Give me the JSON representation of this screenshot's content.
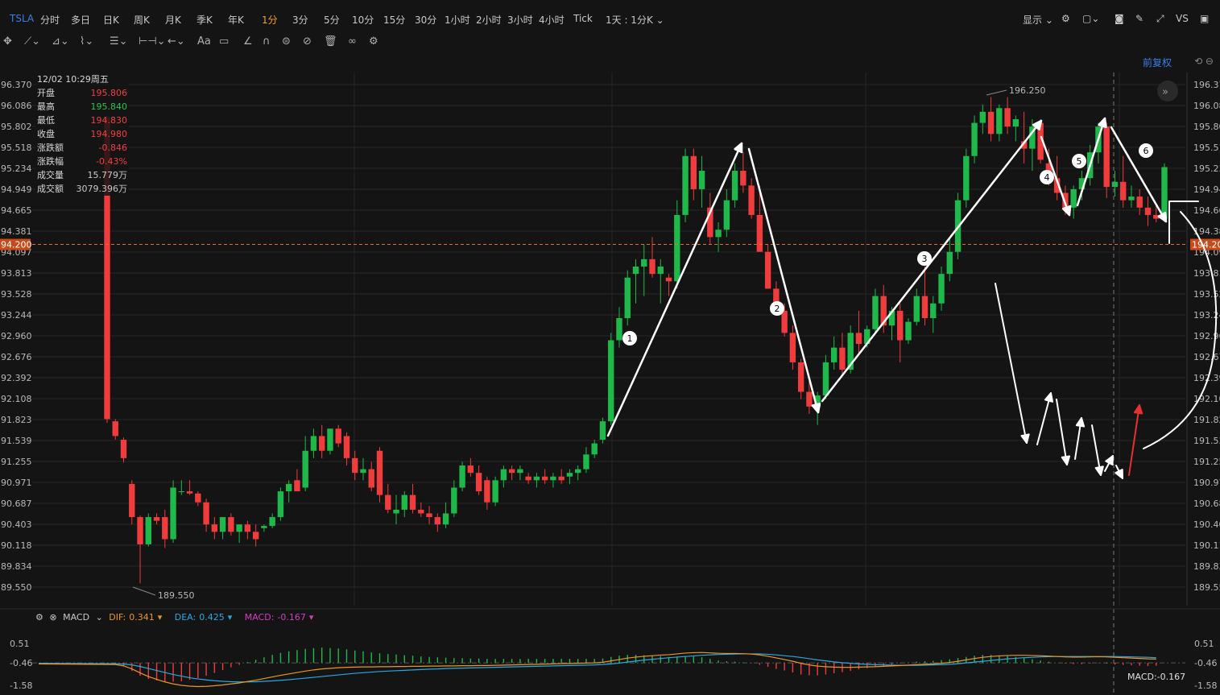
{
  "topbar": {
    "symbol": "TSLA",
    "periods": [
      "分时",
      "多日",
      "日K",
      "周K",
      "月K",
      "季K",
      "年K",
      "1分",
      "3分",
      "5分",
      "10分",
      "15分",
      "30分",
      "1小时",
      "2小时",
      "3小时",
      "4小时",
      "Tick"
    ],
    "active_period": "1分",
    "range_label": "1天 : 1分K",
    "display_label": "显示",
    "vs_label": "VS"
  },
  "toolbar": {
    "tools": [
      "move-tool",
      "line-tool",
      "channel-tool",
      "pattern-tool",
      "fib-tool",
      "measure-tool",
      "arrow-tool",
      "text-tool",
      "note-tool",
      "ruler-tool",
      "magnet-tool",
      "hide-tool",
      "lock-tool",
      "delete-tool",
      "link-tool",
      "settings-tool"
    ],
    "text_tool_label": "Aa"
  },
  "restore_label": "前复权",
  "info_box": {
    "date": "12/02 10:29周五",
    "rows": [
      {
        "label": "开盘",
        "value": "195.806",
        "color": "red"
      },
      {
        "label": "最高",
        "value": "195.840",
        "color": "green"
      },
      {
        "label": "最低",
        "value": "194.830",
        "color": "red"
      },
      {
        "label": "收盘",
        "value": "194.980",
        "color": "red"
      },
      {
        "label": "涨跌额",
        "value": "-0.846",
        "color": "red"
      },
      {
        "label": "涨跌幅",
        "value": "-0.43%",
        "color": "red"
      },
      {
        "label": "成交量",
        "value": "15.779万",
        "color": "white"
      },
      {
        "label": "成交额",
        "value": "3079.396万",
        "color": "white"
      }
    ]
  },
  "macd": {
    "label": "MACD",
    "dif_label": "DIF:",
    "dif_value": "0.341",
    "dea_label": "DEA:",
    "dea_value": "0.425",
    "macd_label": "MACD:",
    "macd_value": "-0.167",
    "axis_ticks": [
      "0.51",
      "-0.46",
      "-1.58"
    ],
    "bottom_readout": "MACD:-0.167"
  },
  "colors": {
    "up": "#1fb84a",
    "down": "#f03c3c",
    "bg": "#141414",
    "grid": "#262626",
    "price_line": "#e07020",
    "dif": "#e8962a",
    "dea": "#2aa8e0",
    "annotation": "#ffffff",
    "accent": "#3b7ee8"
  },
  "chart_data": {
    "type": "candlestick",
    "symbol": "TSLA",
    "interval": "1分",
    "y_ticks": [
      96.37,
      96.086,
      95.802,
      95.518,
      95.234,
      94.949,
      94.665,
      94.381,
      94.097,
      93.813,
      93.528,
      93.244,
      92.96,
      92.676,
      92.392,
      92.108,
      91.823,
      91.539,
      91.255,
      90.971,
      90.687,
      90.403,
      90.118,
      89.834,
      89.55
    ],
    "y_tick_labels_left": [
      "96.370",
      "96.086",
      "95.802",
      "95.518",
      "95.234",
      "94.949",
      "94.665",
      "94.381",
      "94.097",
      "93.813",
      "93.528",
      "93.244",
      "92.960",
      "92.676",
      "92.392",
      "92.108",
      "91.823",
      "91.539",
      "91.255",
      "90.971",
      "90.687",
      "90.403",
      "90.118",
      "89.834",
      "89.550"
    ],
    "y_tick_labels_right": [
      "196.37",
      "196.08",
      "195.80",
      "195.51",
      "195.23",
      "194.94",
      "194.66",
      "194.38",
      "194.09",
      "193.81",
      "193.52",
      "193.24",
      "192.96",
      "192.67",
      "192.39",
      "192.10",
      "191.82",
      "191.53",
      "191.25",
      "190.97",
      "190.68",
      "190.40",
      "190.11",
      "189.83",
      "189.55"
    ],
    "ylim": [
      189.5,
      196.5
    ],
    "current_price": 194.2,
    "current_price_label": "94.200",
    "right_price_label": "194.20",
    "high_marker": {
      "value": 196.25,
      "label": "196.250"
    },
    "low_marker": {
      "value": 189.55,
      "label": "189.550"
    },
    "candles": [
      [
        195.93,
        195.95,
        191.78,
        191.83
      ],
      [
        191.8,
        191.83,
        191.55,
        191.6
      ],
      [
        191.55,
        191.58,
        191.24,
        191.3
      ],
      [
        190.95,
        191.0,
        190.4,
        190.5
      ],
      [
        190.5,
        190.52,
        189.6,
        190.13
      ],
      [
        190.13,
        190.55,
        190.1,
        190.5
      ],
      [
        190.5,
        190.55,
        190.4,
        190.45
      ],
      [
        190.5,
        190.6,
        190.08,
        190.2
      ],
      [
        190.2,
        191.0,
        190.15,
        190.9
      ],
      [
        190.85,
        191.0,
        190.8,
        190.85
      ],
      [
        190.85,
        191.0,
        190.8,
        190.82
      ],
      [
        190.82,
        190.85,
        190.65,
        190.7
      ],
      [
        190.7,
        190.75,
        190.3,
        190.4
      ],
      [
        190.4,
        190.5,
        190.2,
        190.3
      ],
      [
        190.3,
        190.5,
        190.2,
        190.5
      ],
      [
        190.5,
        190.55,
        190.25,
        190.3
      ],
      [
        190.3,
        190.4,
        190.15,
        190.4
      ],
      [
        190.4,
        190.45,
        190.2,
        190.3
      ],
      [
        190.3,
        190.4,
        190.1,
        190.2
      ],
      [
        190.35,
        190.4,
        190.3,
        190.38
      ],
      [
        190.38,
        190.55,
        190.35,
        190.5
      ],
      [
        190.5,
        190.9,
        190.45,
        190.85
      ],
      [
        190.85,
        191.0,
        190.7,
        190.95
      ],
      [
        191.0,
        191.15,
        190.85,
        190.85
      ],
      [
        190.9,
        191.6,
        190.85,
        191.4
      ],
      [
        191.4,
        191.7,
        191.3,
        191.6
      ],
      [
        191.6,
        191.75,
        191.3,
        191.4
      ],
      [
        191.4,
        191.7,
        191.35,
        191.7
      ],
      [
        191.7,
        191.75,
        191.45,
        191.5
      ],
      [
        191.6,
        191.65,
        191.2,
        191.3
      ],
      [
        191.3,
        191.4,
        191.0,
        191.1
      ],
      [
        191.1,
        191.3,
        191.0,
        191.15
      ],
      [
        191.15,
        191.25,
        190.85,
        190.9
      ],
      [
        191.4,
        191.45,
        190.7,
        190.8
      ],
      [
        190.8,
        190.95,
        190.55,
        190.6
      ],
      [
        190.55,
        190.8,
        190.4,
        190.6
      ],
      [
        190.6,
        190.85,
        190.5,
        190.8
      ],
      [
        190.8,
        190.95,
        190.55,
        190.6
      ],
      [
        190.6,
        190.7,
        190.5,
        190.55
      ],
      [
        190.55,
        190.65,
        190.4,
        190.5
      ],
      [
        190.5,
        190.55,
        190.3,
        190.4
      ],
      [
        190.4,
        190.7,
        190.35,
        190.55
      ],
      [
        190.55,
        191.0,
        190.5,
        190.9
      ],
      [
        190.9,
        191.25,
        190.85,
        191.2
      ],
      [
        191.2,
        191.3,
        191.05,
        191.1
      ],
      [
        191.1,
        191.2,
        190.8,
        190.85
      ],
      [
        191.0,
        191.05,
        190.6,
        190.7
      ],
      [
        190.7,
        191.05,
        190.65,
        191.0
      ],
      [
        191.0,
        191.2,
        190.9,
        191.15
      ],
      [
        191.15,
        191.2,
        191.0,
        191.1
      ],
      [
        191.1,
        191.2,
        191.0,
        191.15
      ],
      [
        191.05,
        191.1,
        190.95,
        191.0
      ],
      [
        191.0,
        191.1,
        190.9,
        191.05
      ],
      [
        191.05,
        191.15,
        190.95,
        191.0
      ],
      [
        191.0,
        191.1,
        190.9,
        191.05
      ],
      [
        191.05,
        191.15,
        190.95,
        191.0
      ],
      [
        191.05,
        191.15,
        190.95,
        191.1
      ],
      [
        191.1,
        191.2,
        191.0,
        191.15
      ],
      [
        191.15,
        191.45,
        191.1,
        191.35
      ],
      [
        191.35,
        191.55,
        191.3,
        191.5
      ],
      [
        191.55,
        191.85,
        191.5,
        191.8
      ],
      [
        191.8,
        193.0,
        191.75,
        192.9
      ],
      [
        192.9,
        193.35,
        192.8,
        193.2
      ],
      [
        193.2,
        193.85,
        193.1,
        193.75
      ],
      [
        193.8,
        194.0,
        193.4,
        193.9
      ],
      [
        193.9,
        194.2,
        193.5,
        194.0
      ],
      [
        194.0,
        194.3,
        193.75,
        193.8
      ],
      [
        193.8,
        194.0,
        193.4,
        193.9
      ],
      [
        193.75,
        193.8,
        193.5,
        193.7
      ],
      [
        193.7,
        194.8,
        193.6,
        194.6
      ],
      [
        194.6,
        195.5,
        194.5,
        195.4
      ],
      [
        195.4,
        195.5,
        194.8,
        194.95
      ],
      [
        194.95,
        195.4,
        194.7,
        195.2
      ],
      [
        194.7,
        194.9,
        194.2,
        194.3
      ],
      [
        194.3,
        194.5,
        194.1,
        194.4
      ],
      [
        194.4,
        194.95,
        194.3,
        194.8
      ],
      [
        194.8,
        195.3,
        194.7,
        195.2
      ],
      [
        195.2,
        195.45,
        194.9,
        195.0
      ],
      [
        195.0,
        195.1,
        194.55,
        194.6
      ],
      [
        194.6,
        195.0,
        194.2,
        194.1
      ],
      [
        194.1,
        194.2,
        193.6,
        193.6
      ],
      [
        193.6,
        193.7,
        193.3,
        193.3
      ],
      [
        193.3,
        193.4,
        192.95,
        193.0
      ],
      [
        193.0,
        193.1,
        192.5,
        192.6
      ],
      [
        192.6,
        192.65,
        192.1,
        192.2
      ],
      [
        192.2,
        192.4,
        191.9,
        192.0
      ],
      [
        192.0,
        192.2,
        191.75,
        192.15
      ],
      [
        192.15,
        192.7,
        192.1,
        192.6
      ],
      [
        192.6,
        192.95,
        192.5,
        192.8
      ],
      [
        192.8,
        193.0,
        192.4,
        192.5
      ],
      [
        192.5,
        193.1,
        192.45,
        193.0
      ],
      [
        193.0,
        193.3,
        192.7,
        192.85
      ],
      [
        192.85,
        193.1,
        192.8,
        193.05
      ],
      [
        193.05,
        193.6,
        193.0,
        193.5
      ],
      [
        193.5,
        193.65,
        193.0,
        193.1
      ],
      [
        193.1,
        193.35,
        192.9,
        193.3
      ],
      [
        193.3,
        193.4,
        192.6,
        192.9
      ],
      [
        192.9,
        193.2,
        192.85,
        193.15
      ],
      [
        193.15,
        193.6,
        193.1,
        193.5
      ],
      [
        193.5,
        193.9,
        193.1,
        193.2
      ],
      [
        193.2,
        193.5,
        193.0,
        193.4
      ],
      [
        193.4,
        193.9,
        193.3,
        193.8
      ],
      [
        193.8,
        194.3,
        193.7,
        194.1
      ],
      [
        194.1,
        194.9,
        194.0,
        194.8
      ],
      [
        194.8,
        195.5,
        194.7,
        195.4
      ],
      [
        195.4,
        195.95,
        195.3,
        195.85
      ],
      [
        195.85,
        196.1,
        195.7,
        196.0
      ],
      [
        196.0,
        196.2,
        195.6,
        195.7
      ],
      [
        195.7,
        196.1,
        195.6,
        196.05
      ],
      [
        196.05,
        196.2,
        195.7,
        195.8
      ],
      [
        195.8,
        195.95,
        195.6,
        195.9
      ],
      [
        195.6,
        196.0,
        195.3,
        195.5
      ],
      [
        195.5,
        195.9,
        195.2,
        195.8
      ],
      [
        195.85,
        195.9,
        195.3,
        195.35
      ],
      [
        195.3,
        195.5,
        195.0,
        195.1
      ],
      [
        195.1,
        195.4,
        194.8,
        194.9
      ],
      [
        194.9,
        195.0,
        194.6,
        194.7
      ],
      [
        194.7,
        195.0,
        194.55,
        194.95
      ],
      [
        194.95,
        195.2,
        194.8,
        195.1
      ],
      [
        195.1,
        195.55,
        195.0,
        195.45
      ],
      [
        195.45,
        195.85,
        195.3,
        195.8
      ],
      [
        195.8,
        195.85,
        194.83,
        194.98
      ],
      [
        194.98,
        195.2,
        194.85,
        195.05
      ],
      [
        195.05,
        195.4,
        194.7,
        194.8
      ],
      [
        194.8,
        195.0,
        194.7,
        194.85
      ],
      [
        194.85,
        194.95,
        194.6,
        194.7
      ],
      [
        194.7,
        194.85,
        194.45,
        194.6
      ],
      [
        194.6,
        194.75,
        194.5,
        194.55
      ],
      [
        194.55,
        195.3,
        194.5,
        195.25
      ]
    ],
    "macd_series": {
      "dif": [
        -0.05,
        -0.08,
        -0.15,
        -0.3,
        -0.5,
        -0.68,
        -0.82,
        -0.95,
        -1.05,
        -1.12,
        -1.16,
        -1.18,
        -1.17,
        -1.14,
        -1.1,
        -1.05,
        -1.0,
        -0.93,
        -0.86,
        -0.78,
        -0.7,
        -0.62,
        -0.55,
        -0.48,
        -0.41,
        -0.35,
        -0.3,
        -0.27,
        -0.24,
        -0.22,
        -0.21,
        -0.2,
        -0.2,
        -0.19,
        -0.19,
        -0.18,
        -0.18,
        -0.17,
        -0.17,
        -0.16,
        -0.16,
        -0.15,
        -0.15,
        -0.14,
        -0.14,
        -0.13,
        -0.13,
        -0.12,
        -0.11,
        -0.1,
        -0.09,
        -0.08,
        -0.07,
        -0.06,
        -0.05,
        -0.04,
        -0.03,
        -0.02,
        -0.01,
        0.0,
        0.03,
        0.1,
        0.17,
        0.24,
        0.29,
        0.33,
        0.36,
        0.39,
        0.41,
        0.45,
        0.49,
        0.51,
        0.52,
        0.5,
        0.48,
        0.47,
        0.47,
        0.46,
        0.44,
        0.4,
        0.33,
        0.25,
        0.17,
        0.08,
        -0.02,
        -0.1,
        -0.16,
        -0.19,
        -0.21,
        -0.22,
        -0.22,
        -0.21,
        -0.2,
        -0.19,
        -0.17,
        -0.15,
        -0.13,
        -0.11,
        -0.09,
        -0.07,
        -0.05,
        -0.02,
        0.02,
        0.08,
        0.15,
        0.22,
        0.28,
        0.32,
        0.35,
        0.37,
        0.38,
        0.38,
        0.37,
        0.36,
        0.34,
        0.32,
        0.3,
        0.29,
        0.29,
        0.3,
        0.31,
        0.3,
        0.28,
        0.26,
        0.24,
        0.22,
        0.2,
        0.19
      ],
      "dea": [
        -0.02,
        -0.04,
        -0.06,
        -0.1,
        -0.18,
        -0.28,
        -0.38,
        -0.48,
        -0.58,
        -0.66,
        -0.74,
        -0.8,
        -0.85,
        -0.89,
        -0.92,
        -0.94,
        -0.95,
        -0.95,
        -0.94,
        -0.92,
        -0.9,
        -0.87,
        -0.84,
        -0.8,
        -0.76,
        -0.72,
        -0.68,
        -0.64,
        -0.6,
        -0.56,
        -0.52,
        -0.49,
        -0.46,
        -0.43,
        -0.41,
        -0.39,
        -0.37,
        -0.35,
        -0.33,
        -0.31,
        -0.3,
        -0.28,
        -0.27,
        -0.26,
        -0.25,
        -0.24,
        -0.23,
        -0.22,
        -0.21,
        -0.2,
        -0.19,
        -0.18,
        -0.17,
        -0.16,
        -0.15,
        -0.14,
        -0.13,
        -0.12,
        -0.11,
        -0.1,
        -0.08,
        -0.05,
        -0.01,
        0.04,
        0.09,
        0.14,
        0.18,
        0.22,
        0.26,
        0.29,
        0.32,
        0.35,
        0.38,
        0.4,
        0.42,
        0.43,
        0.44,
        0.45,
        0.45,
        0.45,
        0.43,
        0.4,
        0.36,
        0.32,
        0.27,
        0.21,
        0.15,
        0.1,
        0.05,
        0.01,
        -0.02,
        -0.05,
        -0.07,
        -0.09,
        -0.1,
        -0.11,
        -0.12,
        -0.12,
        -0.12,
        -0.11,
        -0.1,
        -0.09,
        -0.07,
        -0.04,
        0.0,
        0.04,
        0.08,
        0.12,
        0.16,
        0.2,
        0.23,
        0.26,
        0.28,
        0.3,
        0.31,
        0.32,
        0.32,
        0.32,
        0.32,
        0.32,
        0.32,
        0.32,
        0.32,
        0.31,
        0.3,
        0.29,
        0.28,
        0.26
      ]
    }
  }
}
